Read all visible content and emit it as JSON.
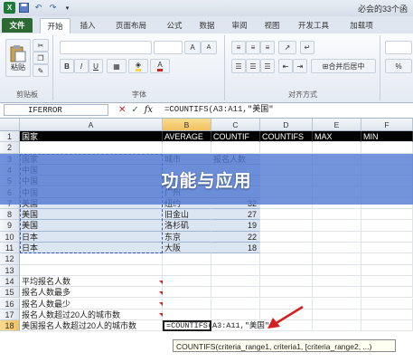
{
  "window": {
    "title": "必会的33个函"
  },
  "tabs": [
    "文件",
    "开始",
    "插入",
    "页面布局",
    "公式",
    "数据",
    "审阅",
    "视图",
    "开发工具",
    "加载项"
  ],
  "ribbon": {
    "paste_label": "粘贴",
    "clipboard_group": "剪贴板",
    "font_group": "字体",
    "align_group": "对齐方式",
    "merge_label": "合并后居中",
    "bold": "B",
    "italic": "I",
    "underline": "U"
  },
  "formula_bar": {
    "name_box": "IFERROR",
    "cancel": "✕",
    "enter": "✓",
    "fx": "fx",
    "formula": "=COUNTIFS(A3:A11,\"美国\""
  },
  "columns": [
    "A",
    "B",
    "C",
    "D",
    "E",
    "F"
  ],
  "rows": [
    {
      "num": "1",
      "a": "国家",
      "b": "AVERAGE",
      "c": "COUNTIF",
      "d": "COUNTIFS",
      "e": "MAX",
      "f": "MIN"
    },
    {
      "num": "2",
      "a": "",
      "b": "",
      "c": "",
      "d": "",
      "e": "",
      "f": ""
    },
    {
      "num": "3",
      "a": "国家",
      "b": "城市",
      "c": "报名人数",
      "d": "",
      "e": "",
      "f": ""
    },
    {
      "num": "4",
      "a": "中国",
      "b": "",
      "c": "",
      "d": "",
      "e": "",
      "f": ""
    },
    {
      "num": "5",
      "a": "中国",
      "b": "",
      "c": "",
      "d": "",
      "e": "",
      "f": ""
    },
    {
      "num": "6",
      "a": "中国",
      "b": "广州",
      "c": "",
      "d": "",
      "e": "",
      "f": ""
    },
    {
      "num": "7",
      "a": "美国",
      "b": "纽约",
      "c": "32",
      "d": "",
      "e": "",
      "f": ""
    },
    {
      "num": "8",
      "a": "美国",
      "b": "旧金山",
      "c": "27",
      "d": "",
      "e": "",
      "f": ""
    },
    {
      "num": "9",
      "a": "美国",
      "b": "洛杉矶",
      "c": "19",
      "d": "",
      "e": "",
      "f": ""
    },
    {
      "num": "10",
      "a": "日本",
      "b": "东京",
      "c": "22",
      "d": "",
      "e": "",
      "f": ""
    },
    {
      "num": "11",
      "a": "日本",
      "b": "大阪",
      "c": "18",
      "d": "",
      "e": "",
      "f": ""
    },
    {
      "num": "12",
      "a": "",
      "b": "",
      "c": "",
      "d": "",
      "e": "",
      "f": ""
    },
    {
      "num": "13",
      "a": "",
      "b": "",
      "c": "",
      "d": "",
      "e": "",
      "f": ""
    },
    {
      "num": "14",
      "a": "平均报名人数",
      "b": "",
      "c": "",
      "d": "",
      "e": "",
      "f": ""
    },
    {
      "num": "15",
      "a": "报名人数最多",
      "b": "",
      "c": "",
      "d": "",
      "e": "",
      "f": ""
    },
    {
      "num": "16",
      "a": "报名人数最少",
      "b": "",
      "c": "",
      "d": "",
      "e": "",
      "f": ""
    },
    {
      "num": "17",
      "a": "报名人数超过20人的城市数",
      "b": "",
      "c": "",
      "d": "",
      "e": "",
      "f": ""
    },
    {
      "num": "18",
      "a": "美国报名人数超过20人的城市数",
      "b": "=COUNTIFS(A3:A11,\"美国\"",
      "c": "",
      "d": "",
      "e": "",
      "f": ""
    }
  ],
  "tooltip": "COUNTIFS(criteria_range1, criteria1, [criteria_range2, ...)",
  "banner": "功能与应用",
  "colors": {
    "header_fill": "#000000",
    "header_text": "#ffffff",
    "table_fill": "#dce6f2",
    "accent": "#5078d2",
    "file_tab": "#2d6a33",
    "arrow": "#d42020"
  }
}
